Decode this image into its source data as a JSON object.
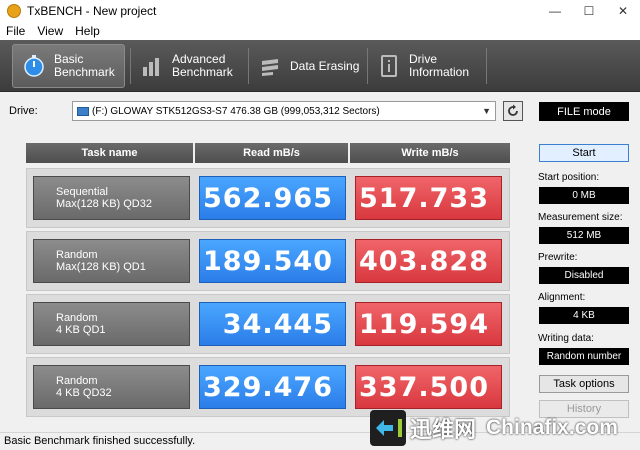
{
  "window": {
    "title": "TxBENCH - New project",
    "minimize": "—",
    "maximize": "☐",
    "close": "✕"
  },
  "menu": [
    "File",
    "View",
    "Help"
  ],
  "toolbar": {
    "basic": {
      "line1": "Basic",
      "line2": "Benchmark",
      "icon": "stopwatch-icon"
    },
    "advanced": {
      "line1": "Advanced",
      "line2": "Benchmark",
      "icon": "bar-chart-icon"
    },
    "erasing": {
      "line1": "Data Erasing",
      "icon": "eraser-icon"
    },
    "drive_info": {
      "line1": "Drive",
      "line2": "Information",
      "icon": "drive-info-icon"
    }
  },
  "drive": {
    "label": "Drive:",
    "selected": "(F:) GLOWAY STK512GS3-S7  476.38 GB (999,053,312 Sectors)"
  },
  "mode": "FILE mode",
  "table": {
    "headers": [
      "Task name",
      "Read mB/s",
      "Write mB/s"
    ],
    "rows": [
      {
        "line1": "Sequential",
        "line2": "Max(128 KB) QD32",
        "read": "562.965",
        "write": "517.733"
      },
      {
        "line1": "Random",
        "line2": "Max(128 KB) QD1",
        "read": "189.540",
        "write": "403.828"
      },
      {
        "line1": "Random",
        "line2": "4 KB QD1",
        "read": "34.445",
        "write": "119.594"
      },
      {
        "line1": "Random",
        "line2": "4 KB QD32",
        "read": "329.476",
        "write": "337.500"
      }
    ]
  },
  "panel": {
    "start": "Start",
    "start_position_label": "Start position:",
    "start_position": "0 MB",
    "measurement_size_label": "Measurement size:",
    "measurement_size": "512 MB",
    "prewrite_label": "Prewrite:",
    "prewrite": "Disabled",
    "alignment_label": "Alignment:",
    "alignment": "4 KB",
    "writing_data_label": "Writing data:",
    "writing_data": "Random number",
    "task_options": "Task options",
    "history": "History"
  },
  "status": "Basic Benchmark finished successfully.",
  "watermark": {
    "cn": "迅维网",
    "en": "Chinafix.com"
  },
  "colors": {
    "read": "#2b7de8",
    "write": "#d8383e",
    "toolbar": "#4a4a4a"
  }
}
